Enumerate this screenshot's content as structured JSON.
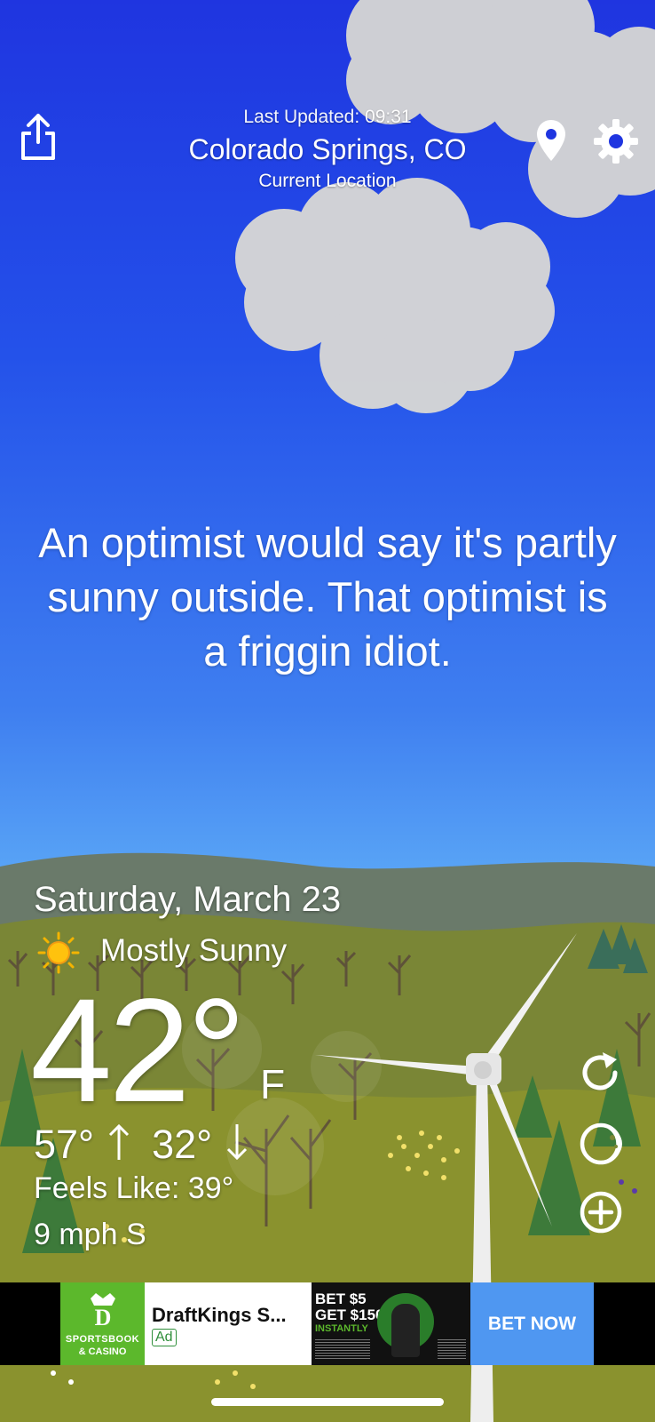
{
  "header": {
    "last_updated": "Last Updated: 09:31",
    "city": "Colorado Springs, CO",
    "location_label": "Current Location"
  },
  "icons": {
    "share": "share-icon",
    "location": "location-pin-icon",
    "settings": "gear-icon",
    "refresh": "refresh-icon",
    "moon": "moon-icon",
    "add": "add-icon",
    "sun": "sun-icon"
  },
  "quote": "An optimist would say it's partly sunny outside. That optimist is a friggin idiot.",
  "weather": {
    "date": "Saturday, March 23",
    "condition": "Mostly Sunny",
    "temperature": "42°",
    "unit": "F",
    "high": "57°",
    "low": "32°",
    "feels_like": "Feels Like: 39°",
    "wind": "9 mph S"
  },
  "ad": {
    "brand_line1": "SPORTSBOOK",
    "brand_line2": "& CASINO",
    "title": "DraftKings S...",
    "badge": "Ad",
    "promo_line1": "BET $5",
    "promo_line2": "GET $150",
    "promo_line3": "INSTANTLY",
    "cta": "BET NOW"
  },
  "colors": {
    "sky_top": "#1f35e0",
    "sky_bottom": "#5aa6f6",
    "grass": "#7f8a35",
    "ad_green": "#5cb82c",
    "ad_cta": "#4f97f1"
  }
}
